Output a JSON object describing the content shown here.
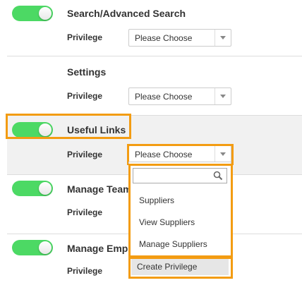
{
  "colors": {
    "toggle_on": "#4cd964",
    "highlight": "#f39c12",
    "section_active_bg": "#f1f1f1"
  },
  "sections": [
    {
      "title": "Search/Advanced Search",
      "toggle_on": true,
      "privilege_label": "Privilege",
      "select_value": "Please Choose"
    },
    {
      "title": "Settings",
      "toggle_on": false,
      "privilege_label": "Privilege",
      "select_value": "Please Choose"
    },
    {
      "title": "Useful Links",
      "toggle_on": true,
      "privilege_label": "Privilege",
      "select_value": "Please Choose"
    },
    {
      "title": "Manage Team",
      "toggle_on": true,
      "privilege_label": "Privilege",
      "select_value": ""
    },
    {
      "title": "Manage Emp",
      "toggle_on": true,
      "privilege_label": "Privilege",
      "select_value": ""
    }
  ],
  "dropdown": {
    "search_value": "",
    "search_icon": "search-icon",
    "options": [
      "Suppliers",
      "View Suppliers",
      "Manage Suppliers"
    ],
    "create_label": "Create Privilege"
  }
}
